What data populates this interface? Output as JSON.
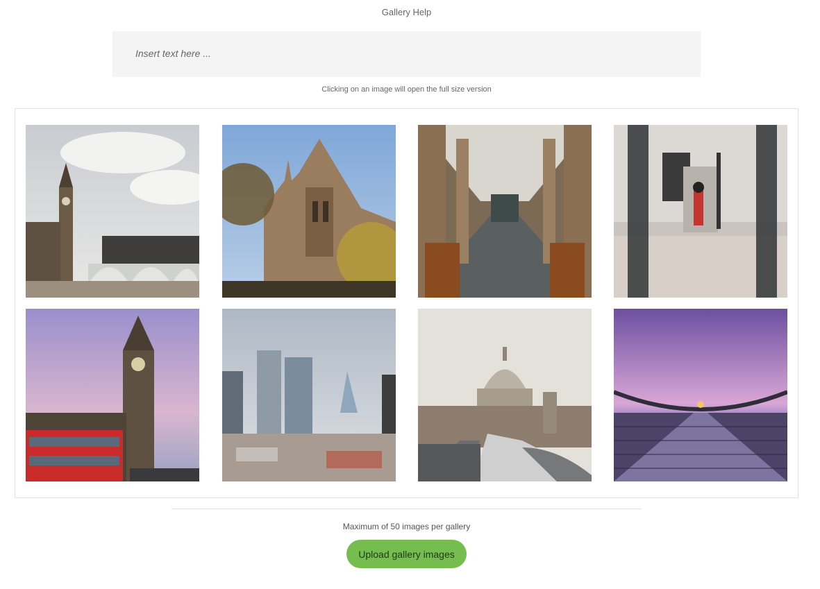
{
  "header": {
    "title": "Gallery Help"
  },
  "editor": {
    "placeholder": "Insert text here ..."
  },
  "hint": "Clicking on an image will open the full size version",
  "gallery": {
    "images": [
      {
        "name": "big-ben-westminster-bridge-thumb"
      },
      {
        "name": "natural-history-museum-thumb"
      },
      {
        "name": "library-colonnade-thumb"
      },
      {
        "name": "queens-guard-thumb"
      },
      {
        "name": "big-ben-red-bus-thumb"
      },
      {
        "name": "city-skyline-thumb"
      },
      {
        "name": "st-pauls-cathedral-thumb"
      },
      {
        "name": "millennium-bridge-thumb"
      }
    ]
  },
  "footer": {
    "max_note": "Maximum of 50 images per gallery",
    "upload_label": "Upload gallery images"
  },
  "colors": {
    "accent": "#76bd4f",
    "panel": "#f4f4f4",
    "border": "#e2e2e2"
  }
}
